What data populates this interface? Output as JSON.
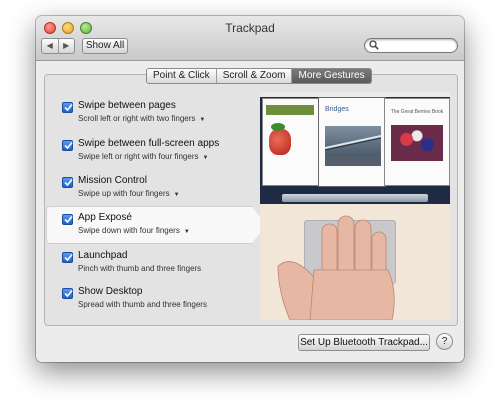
{
  "window": {
    "title": "Trackpad"
  },
  "toolbar": {
    "back": "◀",
    "forward": "▶",
    "show_all": "Show All",
    "search_placeholder": ""
  },
  "tabs": [
    {
      "label": "Point & Click",
      "selected": false
    },
    {
      "label": "Scroll & Zoom",
      "selected": false
    },
    {
      "label": "More Gestures",
      "selected": true
    }
  ],
  "gestures": [
    {
      "title": "Swipe between pages",
      "subtitle": "Scroll left or right with two fingers",
      "checked": true,
      "dropdown": true
    },
    {
      "title": "Swipe between full-screen apps",
      "subtitle": "Swipe left or right with four fingers",
      "checked": true,
      "dropdown": true
    },
    {
      "title": "Mission Control",
      "subtitle": "Swipe up with four fingers",
      "checked": true,
      "dropdown": true
    },
    {
      "title": "App Exposé",
      "subtitle": "Swipe down with four fingers",
      "checked": true,
      "dropdown": true,
      "selected": true
    },
    {
      "title": "Launchpad",
      "subtitle": "Pinch with thumb and three fingers",
      "checked": true,
      "dropdown": false
    },
    {
      "title": "Show Desktop",
      "subtitle": "Spread with thumb and three fingers",
      "checked": true,
      "dropdown": false
    }
  ],
  "preview": {
    "window_titles": [
      "Bridges",
      "The Great Berries Book"
    ]
  },
  "footer": {
    "bluetooth_button": "Set Up Bluetooth Trackpad...",
    "help": "?"
  },
  "colors": {
    "checkbox": "#2a6fd6",
    "selected_tab": "#5f5f5f",
    "window_bg": "#ececec"
  }
}
